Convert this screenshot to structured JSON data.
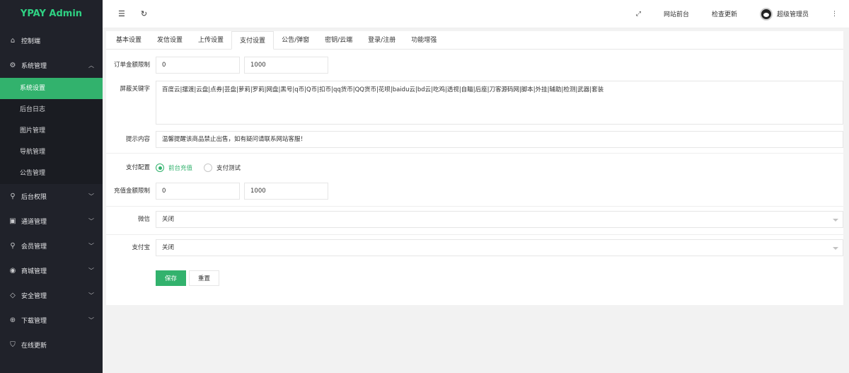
{
  "brand": "YPAY Admin",
  "sidebar": {
    "items": [
      {
        "label": "控制端",
        "icon": "home-icon"
      },
      {
        "label": "系统管理",
        "icon": "gear-icon",
        "expanded": true,
        "children": [
          {
            "label": "系统设置",
            "active": true
          },
          {
            "label": "后台日志"
          },
          {
            "label": "图片管理"
          },
          {
            "label": "导航管理"
          },
          {
            "label": "公告管理"
          }
        ]
      },
      {
        "label": "后台权限",
        "icon": "user-icon"
      },
      {
        "label": "通道管理",
        "icon": "channel-icon"
      },
      {
        "label": "会员管理",
        "icon": "user-icon"
      },
      {
        "label": "商城管理",
        "icon": "shop-icon"
      },
      {
        "label": "安全管理",
        "icon": "diamond-icon"
      },
      {
        "label": "下载管理",
        "icon": "download-icon"
      },
      {
        "label": "在线更新",
        "icon": "shield-icon"
      }
    ]
  },
  "header": {
    "front": "网站前台",
    "update": "检查更新",
    "user": "超级管理员"
  },
  "tabs": [
    "基本设置",
    "发信设置",
    "上传设置",
    "支付设置",
    "公告/弹窗",
    "密钥/云端",
    "登录/注册",
    "功能增强"
  ],
  "active_tab": "支付设置",
  "form": {
    "order_limit": {
      "label": "订单金额限制",
      "min": "0",
      "max": "1000"
    },
    "keywords": {
      "label": "屏蔽关键字",
      "value": "百度云|摆渡|云盘|点券|芸盘|萝莉|罗莉|网盘|黑号|q币|Q币|扣币|qq货币|QQ货币|花呗|baidu云|bd云|吃鸡|透视|自瞄|后座|刀客源码网|脚本|外挂|辅助|检测|武器|套装"
    },
    "tip": {
      "label": "提示内容",
      "value": "温馨提醒该商品禁止出售，如有疑问请联系网站客服！"
    },
    "pay_config": {
      "label": "支付配置",
      "option1": "前台充值",
      "option2": "支付测试"
    },
    "recharge_limit": {
      "label": "充值金额限制",
      "min": "0",
      "max": "1000"
    },
    "wechat": {
      "label": "微信",
      "value": "关闭"
    },
    "alipay": {
      "label": "支付宝",
      "value": "关闭"
    },
    "save": "保存",
    "reset": "重置"
  }
}
